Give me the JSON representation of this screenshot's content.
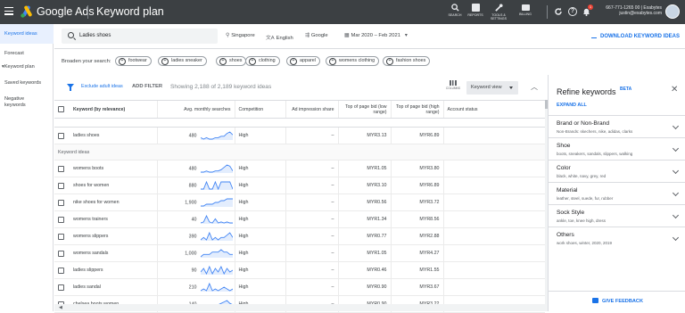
{
  "header": {
    "brand": "Google Ads",
    "page_title": "Keyword plan",
    "tools": [
      {
        "label": "SEARCH",
        "icon": "search-icon"
      },
      {
        "label": "REPORTS",
        "icon": "reports-icon"
      },
      {
        "label": "TOOLS & SETTINGS",
        "icon": "wrench-icon"
      },
      {
        "label": "BILLING",
        "icon": "billing-icon"
      }
    ],
    "notification_count": "1",
    "account_line1": "667-771-1265 00 | Exabytes",
    "account_line2": "justin@exabytes.com"
  },
  "sidebar": {
    "items": [
      "Keyword ideas",
      "Forecast",
      "Keyword plan",
      "Saved keywords",
      "Negative keywords"
    ]
  },
  "search": {
    "keyword": "Ladies shoes",
    "location": "Singapore",
    "language": "English",
    "network": "Google",
    "date_range": "Mar 2020 – Feb 2021",
    "download_label": "DOWNLOAD KEYWORD IDEAS"
  },
  "broaden": {
    "label": "Broaden your search:",
    "chips": [
      "footwear",
      "ladies sneaker",
      "shoes",
      "clothing",
      "apparel",
      "womens clothing",
      "fashion shoes"
    ]
  },
  "toolbar": {
    "include_adult": "Exclude adult ideas",
    "add_filter": "ADD FILTER",
    "showing": "Showing 2,188 of 2,189 keyword ideas",
    "columns": "COLUMNS",
    "view": "Keyword view"
  },
  "table": {
    "headers": {
      "keyword": "Keyword (by relevance)",
      "searches": "Avg. monthly searches",
      "competition": "Competition",
      "impression": "Ad impression share",
      "bid_low": "Top of page bid (low range)",
      "bid_high": "Top of page bid (high range)",
      "status": "Account status"
    },
    "provided": [
      {
        "keyword": "ladies shoes",
        "searches": "480",
        "competition": "High",
        "impression": "–",
        "bid_low": "MYR3.13",
        "bid_high": "MYR6.89",
        "trend": [
          5,
          4,
          5,
          4,
          4,
          5,
          5,
          6,
          6,
          8,
          9,
          7
        ]
      }
    ],
    "section_label": "Keyword ideas",
    "rows": [
      {
        "keyword": "womens boots",
        "searches": "480",
        "competition": "High",
        "impression": "–",
        "bid_low": "MYR1.05",
        "bid_high": "MYR3.80",
        "trend": [
          3,
          3,
          4,
          3,
          3,
          4,
          4,
          5,
          7,
          9,
          8,
          4
        ]
      },
      {
        "keyword": "shoes for women",
        "searches": "880",
        "competition": "High",
        "impression": "–",
        "bid_low": "MYR3.10",
        "bid_high": "MYR6.89",
        "trend": [
          6,
          6,
          7,
          6,
          6,
          7,
          6,
          7,
          7,
          7,
          7,
          6
        ]
      },
      {
        "keyword": "nike shoes for women",
        "searches": "1,900",
        "competition": "High",
        "impression": "–",
        "bid_low": "MYR0.56",
        "bid_high": "MYR3.72",
        "trend": [
          4,
          4,
          5,
          5,
          5,
          6,
          6,
          7,
          7,
          8,
          8,
          8
        ]
      },
      {
        "keyword": "womens trainers",
        "searches": "40",
        "competition": "High",
        "impression": "–",
        "bid_low": "MYR1.34",
        "bid_high": "MYR8.56",
        "trend": [
          2,
          3,
          9,
          3,
          2,
          6,
          2,
          3,
          2,
          3,
          2,
          2
        ]
      },
      {
        "keyword": "womens slippers",
        "searches": "390",
        "competition": "High",
        "impression": "–",
        "bid_low": "MYR0.77",
        "bid_high": "MYR2.88",
        "trend": [
          5,
          6,
          5,
          8,
          5,
          6,
          5,
          6,
          6,
          7,
          8,
          6
        ]
      },
      {
        "keyword": "womens sandals",
        "searches": "1,000",
        "competition": "High",
        "impression": "–",
        "bid_low": "MYR1.05",
        "bid_high": "MYR4.27",
        "trend": [
          4,
          5,
          5,
          5,
          6,
          6,
          6,
          7,
          6,
          6,
          5,
          5
        ]
      },
      {
        "keyword": "ladies slippers",
        "searches": "90",
        "competition": "High",
        "impression": "–",
        "bid_low": "MYR0.46",
        "bid_high": "MYR1.55",
        "trend": [
          4,
          6,
          3,
          7,
          3,
          6,
          4,
          7,
          3,
          6,
          4,
          5
        ]
      },
      {
        "keyword": "ladies sandal",
        "searches": "210",
        "competition": "High",
        "impression": "–",
        "bid_low": "MYR0.90",
        "bid_high": "MYR3.67",
        "trend": [
          4,
          5,
          4,
          8,
          4,
          5,
          4,
          5,
          6,
          5,
          4,
          5
        ]
      },
      {
        "keyword": "chelsea boots women",
        "searches": "140",
        "competition": "High",
        "impression": "–",
        "bid_low": "MYR0.90",
        "bid_high": "MYR3.22",
        "trend": [
          3,
          3,
          4,
          4,
          4,
          5,
          5,
          6,
          7,
          8,
          6,
          5
        ]
      }
    ]
  },
  "refine": {
    "title": "Refine keywords",
    "beta": "BETA",
    "expand_all": "EXPAND ALL",
    "sections": [
      {
        "title": "Brand or Non-Brand",
        "sub": "Non-Brands: skechers, nike, adidas, clarks"
      },
      {
        "title": "Shoe",
        "sub": "boots, sneakers, sandals, slippers, walking"
      },
      {
        "title": "Color",
        "sub": "black, white, navy, grey, red"
      },
      {
        "title": "Material",
        "sub": "leather, steel, suede, fur, rubber"
      },
      {
        "title": "Sock Style",
        "sub": "ankle, toe, knee high, dress"
      },
      {
        "title": "Others",
        "sub": "work shoes, winter, 2020, 2019"
      }
    ],
    "feedback": "GIVE FEEDBACK"
  },
  "colors": {
    "topbar": "#3c4043",
    "accent": "#1a73e8",
    "sparkline": "#4285f4"
  }
}
